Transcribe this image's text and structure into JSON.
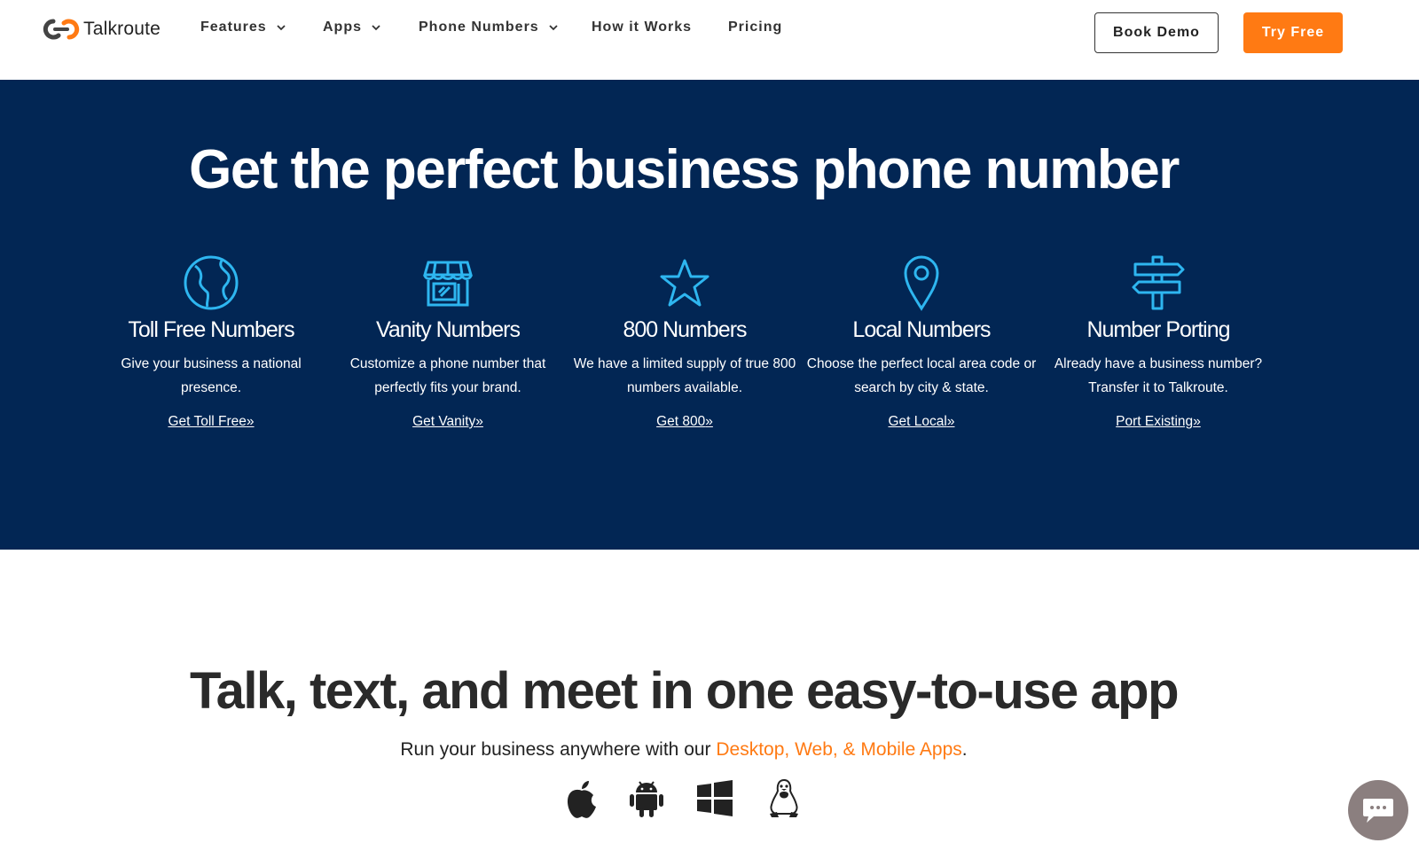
{
  "brand": {
    "name": "Talkroute",
    "accent": "#ff7a13",
    "hero_bg": "#022654"
  },
  "nav": {
    "items": [
      {
        "label": "Features",
        "dropdown": true
      },
      {
        "label": "Apps",
        "dropdown": true
      },
      {
        "label": "Phone Numbers",
        "dropdown": true
      },
      {
        "label": "How it Works",
        "dropdown": false
      },
      {
        "label": "Pricing",
        "dropdown": false
      }
    ],
    "book_demo": "Book Demo",
    "try_free": "Try Free"
  },
  "hero": {
    "title": "Get the perfect business phone number",
    "features": [
      {
        "icon": "globe-icon",
        "title": "Toll Free Numbers",
        "desc": "Give your business a national presence.",
        "link": "Get Toll Free"
      },
      {
        "icon": "storefront-icon",
        "title": "Vanity Numbers",
        "desc": "Customize a phone number that perfectly fits your brand.",
        "link": "Get Vanity"
      },
      {
        "icon": "star-icon",
        "title": "800 Numbers",
        "desc": "We have a limited supply of true 800 numbers available.",
        "link": "Get 800"
      },
      {
        "icon": "map-pin-icon",
        "title": "Local Numbers",
        "desc": "Choose the perfect local area code or search by city & state.",
        "link": "Get Local"
      },
      {
        "icon": "signpost-icon",
        "title": "Number Porting",
        "desc": "Already have a business number? Transfer it to Talkroute.",
        "link": "Port Existing"
      }
    ],
    "link_arrow": "»"
  },
  "apps": {
    "title": "Talk, text, and meet in one easy-to-use app",
    "run_prefix": "Run your business anywhere with our ",
    "run_link": "Desktop, Web, & Mobile Apps",
    "run_suffix": ".",
    "platform_icons": [
      "apple-icon",
      "android-icon",
      "windows-icon",
      "linux-icon"
    ]
  },
  "chat": {
    "icon": "chat-bubble-icon"
  }
}
